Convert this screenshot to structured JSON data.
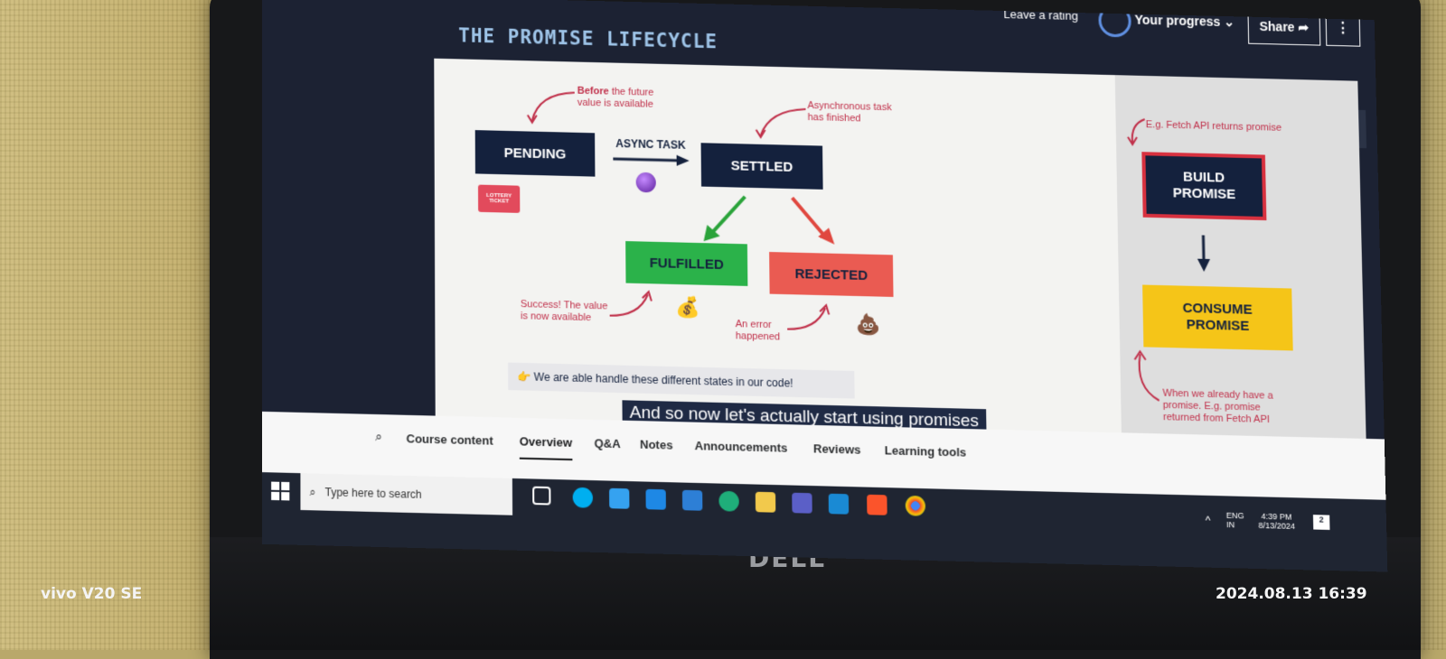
{
  "player": {
    "rating_label": "Leave a rating",
    "progress_label": "Your progress",
    "share_label": "Share",
    "more_label": "⋮",
    "back_label": "←"
  },
  "slide": {
    "title": "THE PROMISE LIFECYCLE",
    "pending": "PENDING",
    "async_task": "ASYNC TASK",
    "settled": "SETTLED",
    "fulfilled": "FULFILLED",
    "rejected": "REJECTED",
    "build_promise": "BUILD PROMISE",
    "consume_promise": "CONSUME PROMISE",
    "lottery": "LOTTERY TICKET",
    "ann_before_bold": "Before",
    "ann_before_rest": "the future value is available",
    "ann_async": "Asynchronous task has finished",
    "ann_fetch": "E.g. Fetch API returns promise",
    "ann_success": "Success! The value is now available",
    "ann_error": "An error happened",
    "ann_consume": "When we already have a promise. E.g. promise returned from Fetch API",
    "footer_note": "We are able handle these different states in our code!"
  },
  "caption": "And so now let's actually start using promises",
  "tabs": [
    {
      "label": "Course content"
    },
    {
      "label": "Overview"
    },
    {
      "label": "Q&A"
    },
    {
      "label": "Notes"
    },
    {
      "label": "Announcements"
    },
    {
      "label": "Reviews"
    },
    {
      "label": "Learning tools"
    }
  ],
  "taskbar": {
    "search_placeholder": "Type here to search",
    "lang1": "ENG",
    "lang2": "IN",
    "time": "4:39 PM",
    "date": "8/13/2024",
    "notif_count": "2"
  },
  "photo": {
    "brand": "DELL",
    "camera_label": "vivo V20 SE",
    "camera_timestamp": "2024.08.13 16:39"
  }
}
